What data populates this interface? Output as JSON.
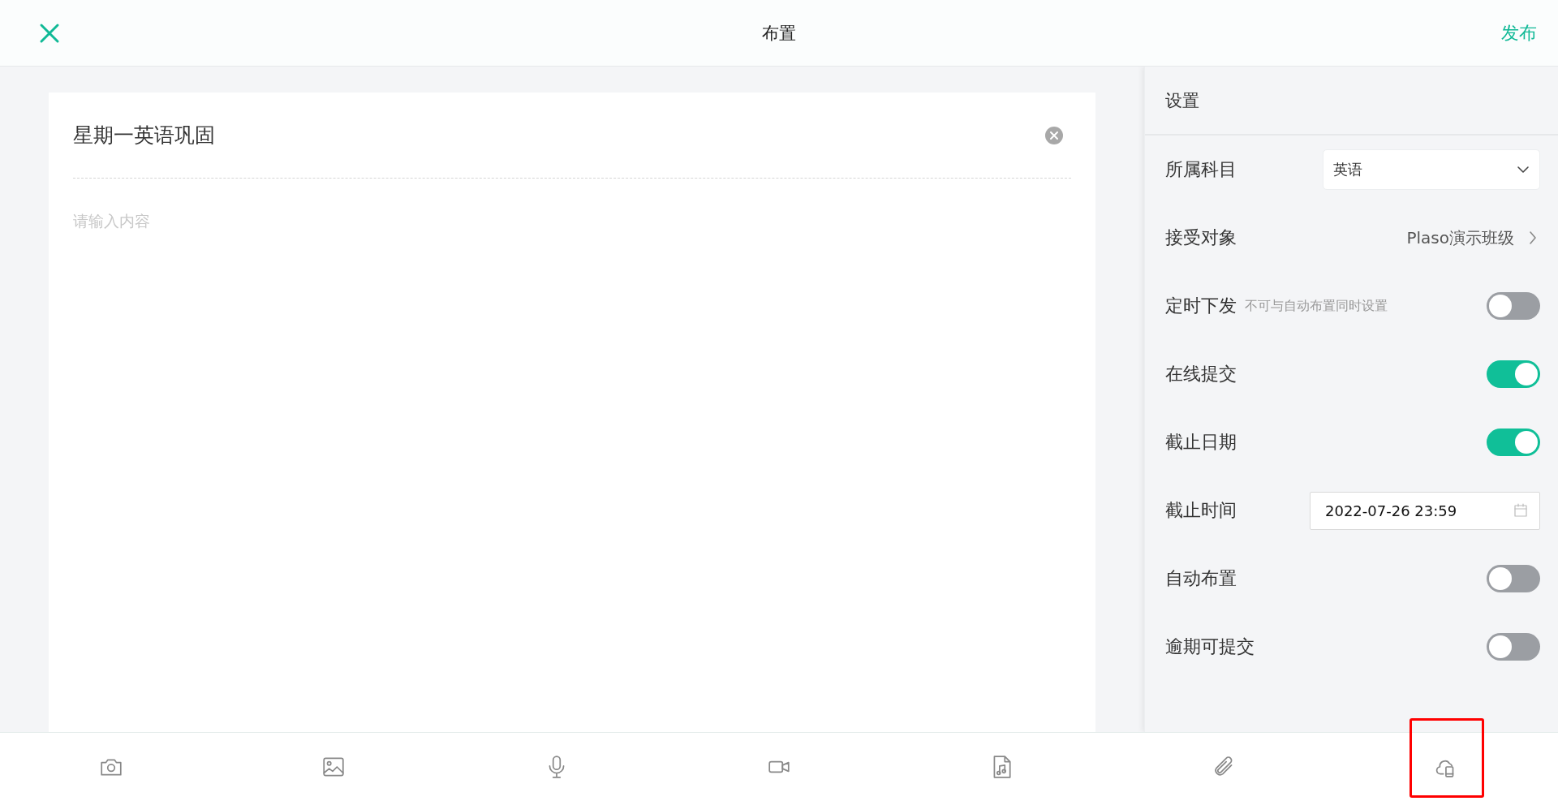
{
  "header": {
    "title": "布置",
    "action": "发布"
  },
  "editor": {
    "title": "星期一英语巩固",
    "placeholder": "请输入内容"
  },
  "settings": {
    "title": "设置",
    "rows": [
      {
        "kind": "select",
        "label": "所属科目",
        "value": "英语"
      },
      {
        "kind": "link",
        "label": "接受对象",
        "value": "Plaso演示班级"
      },
      {
        "kind": "toggle",
        "label": "定时下发",
        "hint": "不可与自动布置同时设置",
        "on": false
      },
      {
        "kind": "toggle",
        "label": "在线提交",
        "on": true
      },
      {
        "kind": "toggle",
        "label": "截止日期",
        "on": true
      },
      {
        "kind": "date",
        "label": "截止时间",
        "value": "2022-07-26 23:59"
      },
      {
        "kind": "toggle",
        "label": "自动布置",
        "on": false
      },
      {
        "kind": "toggle",
        "label": "逾期可提交",
        "on": false
      }
    ]
  },
  "toolbar": [
    {
      "kind": "camera",
      "highlighted": false
    },
    {
      "kind": "image",
      "highlighted": false
    },
    {
      "kind": "microphone",
      "highlighted": false
    },
    {
      "kind": "video",
      "highlighted": false
    },
    {
      "kind": "music-file",
      "highlighted": false
    },
    {
      "kind": "attachment",
      "highlighted": false
    },
    {
      "kind": "cloud-device",
      "highlighted": true
    }
  ]
}
